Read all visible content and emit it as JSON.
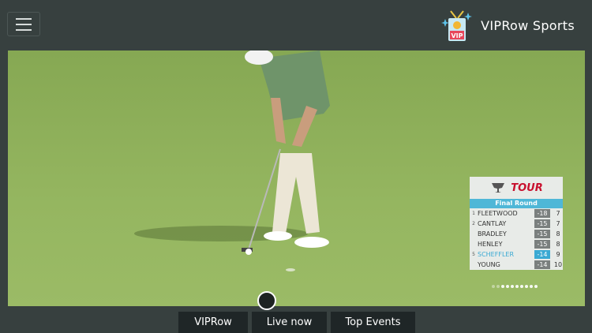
{
  "header": {
    "brand_name": "VIPRow Sports",
    "logo_text": "VIP",
    "menu_icon": "hamburger-menu-icon"
  },
  "video": {
    "leaderboard": {
      "tour_logo": "TOUR",
      "round_label": "Final Round",
      "rows": [
        {
          "pos": "1",
          "name": "FLEETWOOD",
          "score": "-18",
          "thru": "7",
          "highlight": false
        },
        {
          "pos": "2",
          "name": "CANTLAY",
          "score": "-15",
          "thru": "7",
          "highlight": false
        },
        {
          "pos": "",
          "name": "BRADLEY",
          "score": "-15",
          "thru": "8",
          "highlight": false
        },
        {
          "pos": "",
          "name": "HENLEY",
          "score": "-15",
          "thru": "8",
          "highlight": false
        },
        {
          "pos": "5",
          "name": "SCHEFFLER",
          "score": "-14",
          "thru": "9",
          "highlight": true
        },
        {
          "pos": "",
          "name": "YOUNG",
          "score": "-14",
          "thru": "10",
          "highlight": false
        }
      ]
    }
  },
  "bottom_nav": {
    "tabs": [
      {
        "label": "VIPRow"
      },
      {
        "label": "Live now"
      },
      {
        "label": "Top Events"
      }
    ]
  },
  "colors": {
    "background": "#37403f",
    "accent": "#3aa9d3",
    "tab_bg": "#1f2627"
  }
}
